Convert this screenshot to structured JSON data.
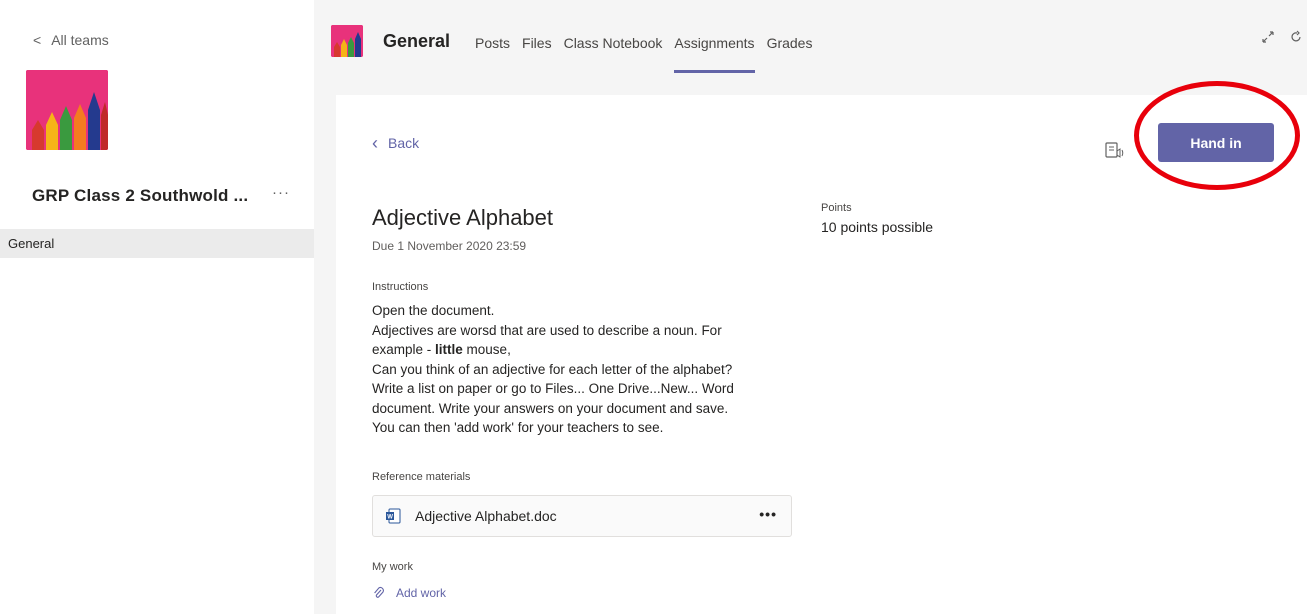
{
  "sidebar": {
    "back_label": "All teams",
    "team_name": "GRP Class 2 Southwold ...",
    "more_label": "···",
    "channels": [
      {
        "label": "General"
      }
    ]
  },
  "header": {
    "channel_title": "General",
    "tabs": [
      {
        "label": "Posts"
      },
      {
        "label": "Files"
      },
      {
        "label": "Class Notebook"
      },
      {
        "label": "Assignments"
      },
      {
        "label": "Grades"
      }
    ],
    "active_tab": "Assignments"
  },
  "assignment": {
    "back_label": "Back",
    "hand_in_label": "Hand in",
    "title": "Adjective Alphabet",
    "due": "Due 1 November 2020 23:59",
    "points_label": "Points",
    "points_value": "10 points possible",
    "instructions_label": "Instructions",
    "instructions_lines": [
      "Open the document.",
      "Adjectives are worsd that are used to describe a noun. For",
      "example - ",
      "Can you think of an adjective for each letter of the alphabet?",
      "Write a list on paper or go to Files... One Drive...New... Word",
      "document. Write your answers on your document and save.",
      "You can then 'add work' for your teachers to see."
    ],
    "example_bold": "little",
    "example_rest": " mouse,",
    "reference_label": "Reference materials",
    "reference_file": "Adjective Alphabet.doc",
    "reference_more": "•••",
    "my_work_label": "My work",
    "add_work_label": "Add work"
  },
  "colors": {
    "accent": "#6264a7",
    "annotation": "#e8000b",
    "team_avatar": "#e8327b"
  }
}
